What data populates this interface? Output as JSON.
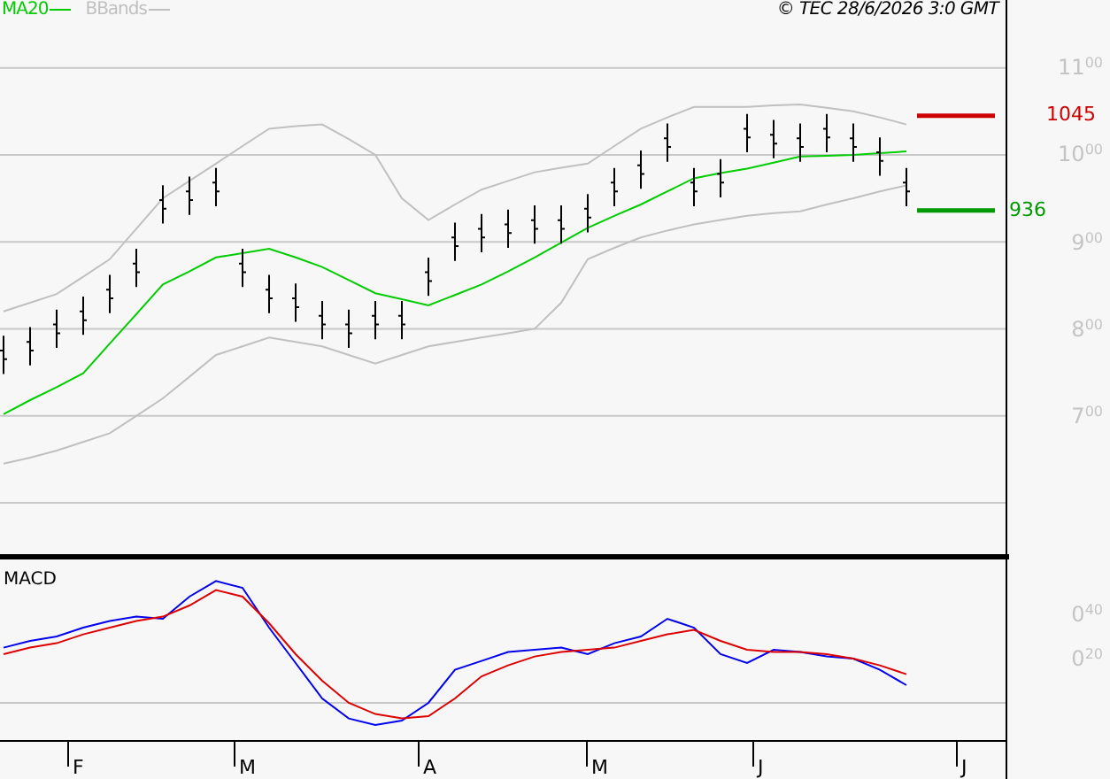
{
  "legend": [
    {
      "label": "MA20",
      "color": "#00cc00"
    },
    {
      "label": "BBands",
      "color": "#c0c0c0"
    }
  ],
  "copyright": "© TEC 28/6/2026 3:0 GMT",
  "price_chart": {
    "y_labels": [
      "11$^{00}$",
      "10$^{00}$",
      "9$^{00}$",
      "8$^{00}$",
      "7$^{00}$"
    ],
    "price_levels": [
      {
        "label": "1045",
        "color": "#cc0000"
      },
      {
        "label": "936",
        "color": "#009900"
      }
    ]
  },
  "macd_chart": {
    "title": "MACD",
    "y_labels": [
      "0$^{40}$",
      "0$^{20}$"
    ]
  },
  "x_labels": [
    "F",
    "M",
    "A",
    "M",
    "J",
    "J"
  ]
}
